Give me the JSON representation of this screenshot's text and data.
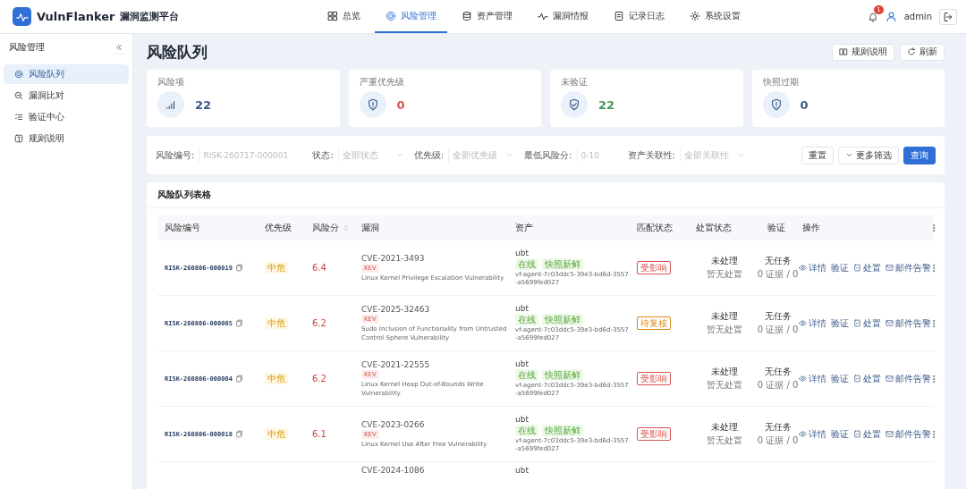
{
  "app": {
    "name": "VulnFlanker",
    "subtitle": "漏洞监测平台"
  },
  "nav": [
    {
      "label": "总览",
      "selected": false
    },
    {
      "label": "风险管理",
      "selected": true
    },
    {
      "label": "资产管理",
      "selected": false
    },
    {
      "label": "漏洞情报",
      "selected": false
    },
    {
      "label": "记录日志",
      "selected": false
    },
    {
      "label": "系统设置",
      "selected": false
    }
  ],
  "user": {
    "notifications": "1",
    "name": "admin"
  },
  "sidebar": {
    "title": "风险管理",
    "items": [
      {
        "label": "风险队列",
        "selected": true
      },
      {
        "label": "漏洞比对",
        "selected": false
      },
      {
        "label": "验证中心",
        "selected": false
      },
      {
        "label": "规则说明",
        "selected": false
      }
    ]
  },
  "page": {
    "title": "风险队列",
    "buttons": [
      "规则说明",
      "刷新"
    ]
  },
  "stats": [
    {
      "label": "风险项",
      "value": "22",
      "color": "#3a5a86"
    },
    {
      "label": "严重优先级",
      "value": "0",
      "color": "#d9534f"
    },
    {
      "label": "未验证",
      "value": "22",
      "color": "#3f9a5a"
    },
    {
      "label": "快照过期",
      "value": "0",
      "color": "#3a5a86"
    }
  ],
  "filters": [
    {
      "label": "风险编号:",
      "placeholder": "RISK-260717-000001",
      "kind": "text"
    },
    {
      "label": "状态:",
      "placeholder": "全部状态",
      "kind": "select"
    },
    {
      "label": "优先级:",
      "placeholder": "全部优先级",
      "kind": "select"
    },
    {
      "label": "最低风险分:",
      "placeholder": "0-10",
      "kind": "text"
    },
    {
      "label": "资产关联性:",
      "placeholder": "全部关联性",
      "kind": "select"
    }
  ],
  "filter_buttons": [
    {
      "label": "重置",
      "kind": "plain"
    },
    {
      "label": "更多筛选",
      "kind": "expand"
    },
    {
      "label": "查询",
      "kind": "primary"
    }
  ],
  "table": {
    "title": "风险队列表格",
    "columns": [
      {
        "label": "风险编号"
      },
      {
        "label": "优先级"
      },
      {
        "label": "风险分",
        "sortable": true
      },
      {
        "label": "漏洞"
      },
      {
        "label": "资产"
      },
      {
        "label": "匹配状态"
      },
      {
        "label": "处置状态"
      },
      {
        "label": "验证"
      },
      {
        "label": "操作"
      }
    ],
    "rows": [
      {
        "id": "RISK-260806-000019",
        "priority": "中危",
        "score": "6.4",
        "cve": "CVE-2021-3493",
        "tag": "KEV",
        "desc": "Linux Kernel Privilege Escalation Vulnerability",
        "asset": "ubt",
        "asset_tags": [
          "在线",
          "快照新鲜"
        ],
        "agent": "vf-agent-7c03ddc5-39e3-bd6d-3557-a5699fed027",
        "match": {
          "label": "受影响",
          "color": "#d9534f"
        },
        "status": "未处理",
        "status_sub": "暂无处置",
        "verify": "无任务",
        "verify_sub": "0 证据 / 0",
        "actions": [
          "详情",
          "验证",
          "处置",
          "邮件告警"
        ]
      },
      {
        "id": "RISK-260806-000005",
        "priority": "中危",
        "score": "6.2",
        "cve": "CVE-2025-32463",
        "tag": "KEV",
        "desc": "Sudo Inclusion of Functionality from Untrusted Control Sphere Vulnerability",
        "asset": "ubt",
        "asset_tags": [
          "在线",
          "快照新鲜"
        ],
        "agent": "vf-agent-7c03ddc5-39e3-bd6d-3557-a5699fed027",
        "match": {
          "label": "待复核",
          "color": "#d98a1f"
        },
        "status": "未处理",
        "status_sub": "暂无处置",
        "verify": "无任务",
        "verify_sub": "0 证据 / 0",
        "actions": [
          "详情",
          "验证",
          "处置",
          "邮件告警"
        ]
      },
      {
        "id": "RISK-260806-000004",
        "priority": "中危",
        "score": "6.2",
        "cve": "CVE-2021-22555",
        "tag": "KEV",
        "desc": "Linux Kernel Heap Out-of-Bounds Write Vulnerability",
        "asset": "ubt",
        "asset_tags": [
          "在线",
          "快照新鲜"
        ],
        "agent": "vf-agent-7c03ddc5-39e3-bd6d-3557-a5699fed027",
        "match": {
          "label": "受影响",
          "color": "#d9534f"
        },
        "status": "未处理",
        "status_sub": "暂无处置",
        "verify": "无任务",
        "verify_sub": "0 证据 / 0",
        "actions": [
          "详情",
          "验证",
          "处置",
          "邮件告警"
        ]
      },
      {
        "id": "RISK-260806-000018",
        "priority": "中危",
        "score": "6.1",
        "cve": "CVE-2023-0266",
        "tag": "KEV",
        "desc": "Linux Kernel Use After Free Vulnerability",
        "asset": "ubt",
        "asset_tags": [
          "在线",
          "快照新鲜"
        ],
        "agent": "vf-agent-7c03ddc5-39e3-bd6d-3557-a5699fed027",
        "match": {
          "label": "受影响",
          "color": "#d9534f"
        },
        "status": "未处理",
        "status_sub": "暂无处置",
        "verify": "无任务",
        "verify_sub": "0 证据 / 0",
        "actions": [
          "详情",
          "验证",
          "处置",
          "邮件告警"
        ]
      },
      {
        "cve": "CVE-2024-1086",
        "asset": "ubt"
      }
    ]
  }
}
